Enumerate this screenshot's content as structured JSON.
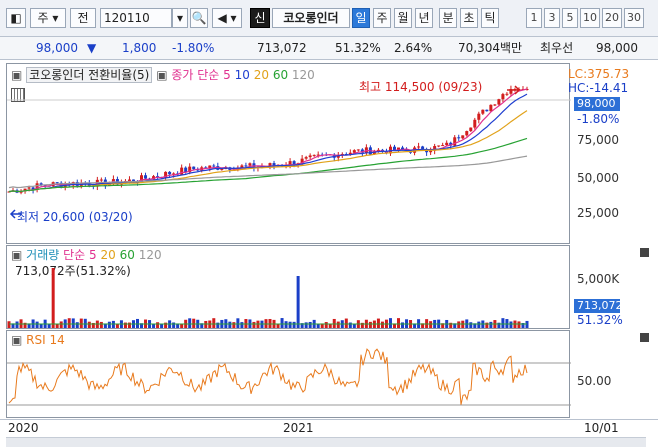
{
  "toolbar": {
    "period": "주",
    "chart_mode": "전",
    "code": "120110",
    "new_label": "신",
    "stock_name": "코오롱인더",
    "intervals": [
      "일",
      "주",
      "월",
      "년",
      "분",
      "초",
      "틱"
    ],
    "active_interval": "일",
    "numbers": [
      "1",
      "3",
      "5",
      "10",
      "20",
      "30"
    ]
  },
  "quote": {
    "price": "98,000",
    "change": "1,800",
    "change_pct": "-1.80%",
    "volume": "713,072",
    "vol_ratio": "51.32%",
    "turnover": "2.64%",
    "amount": "70,304백만",
    "pref_label": "최우선",
    "pref_price": "98,000"
  },
  "price_pane": {
    "title": "코오롱인더 전환비율(5)",
    "ma_label": "종가 단순",
    "ma_periods": [
      "5",
      "10",
      "20",
      "60",
      "120"
    ],
    "ma_colors": [
      "#e0308f",
      "#1f3fd0",
      "#e1a21a",
      "#27a233",
      "#999999"
    ],
    "high_annotation": "최고 114,500 (09/23)",
    "low_annotation": "최저 20,600 (03/20)",
    "lc": "LC:375.73",
    "hc": "HC:-14.41",
    "price_tag": "98,000",
    "change_tag": "-1.80%",
    "y_labels": [
      "75,000",
      "50,000",
      "25,000"
    ]
  },
  "volume_pane": {
    "title": "거래량",
    "ma_label": "단순",
    "ma_periods": [
      "5",
      "20",
      "60",
      "120"
    ],
    "ma_colors": [
      "#e0308f",
      "#e1a21a",
      "#27a233",
      "#999999"
    ],
    "current": "713,072주(51.32%)",
    "y_label": "5,000K",
    "vol_tag": "713,072",
    "ratio_tag": "51.32%"
  },
  "rsi_pane": {
    "title": "RSI 14",
    "y_label": "50.00"
  },
  "x_axis": {
    "labels": [
      "2020",
      "2021"
    ],
    "date_right": "10/01"
  },
  "colors": {
    "up": "#d21d1d",
    "down": "#1a3fc8",
    "rsi": "#e87a1d"
  }
}
